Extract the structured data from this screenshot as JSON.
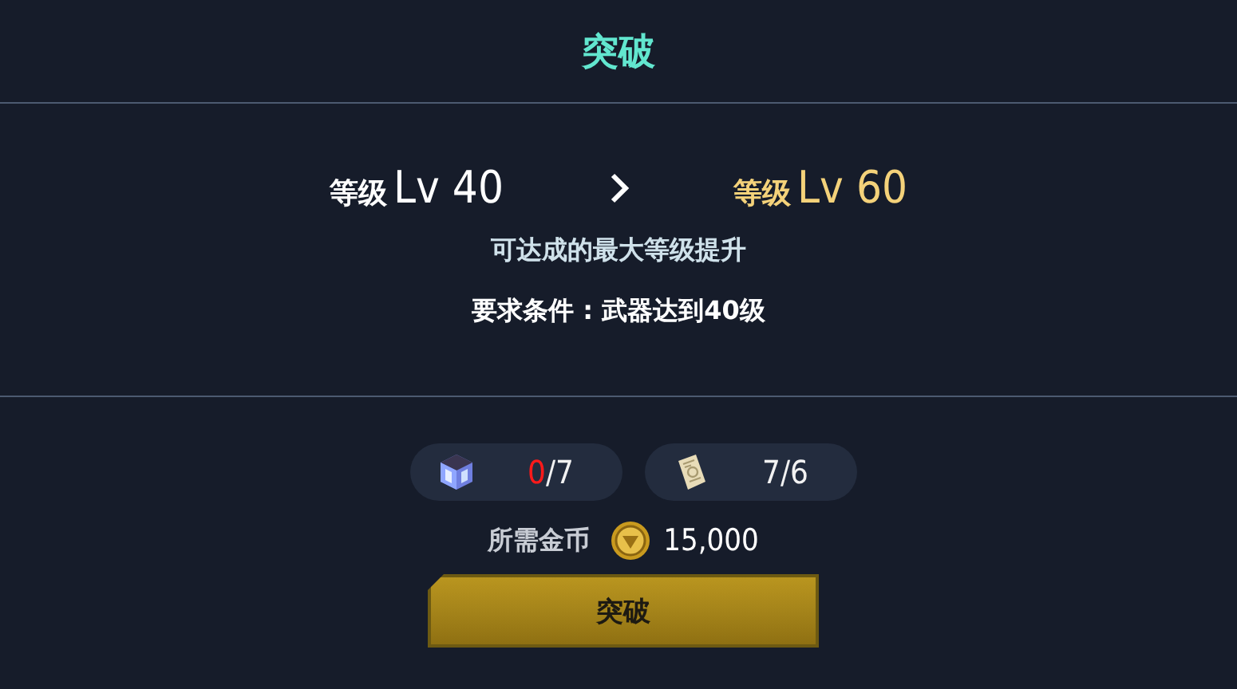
{
  "title": "突破",
  "levels": {
    "from_label": "等级",
    "from_value": "Lv 40",
    "to_label": "等级",
    "to_value": "Lv 60"
  },
  "description": "可达成的最大等级提升",
  "requirement": "要求条件 : 武器达到40级",
  "materials": [
    {
      "kind": "cube",
      "have": "0",
      "need": "/7",
      "enough": false
    },
    {
      "kind": "scroll",
      "have": "7",
      "need": "/6",
      "enough": true
    }
  ],
  "cost": {
    "label": "所需金币",
    "amount": "15,000"
  },
  "button": "突破"
}
